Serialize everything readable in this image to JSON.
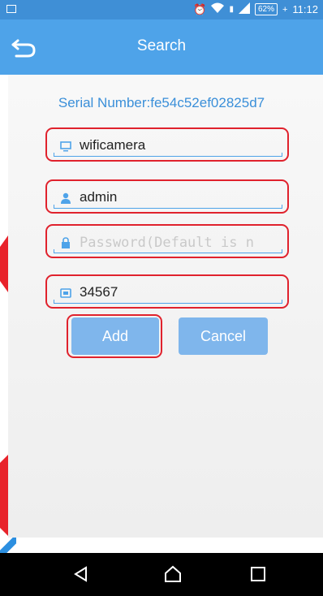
{
  "status_bar": {
    "time": "11:12",
    "battery": "62%"
  },
  "app_bar": {
    "title": "Search"
  },
  "dialog": {
    "serial_label": "Serial Number:fe54c52ef02825d7",
    "name_value": "wificamera",
    "user_value": "admin",
    "password_placeholder": "Password(Default is n",
    "port_value": "34567",
    "add_label": "Add",
    "cancel_label": "Cancel"
  },
  "colors": {
    "accent": "#4ea3e9",
    "highlight": "#e0222d",
    "button": "#7fb6ec"
  }
}
